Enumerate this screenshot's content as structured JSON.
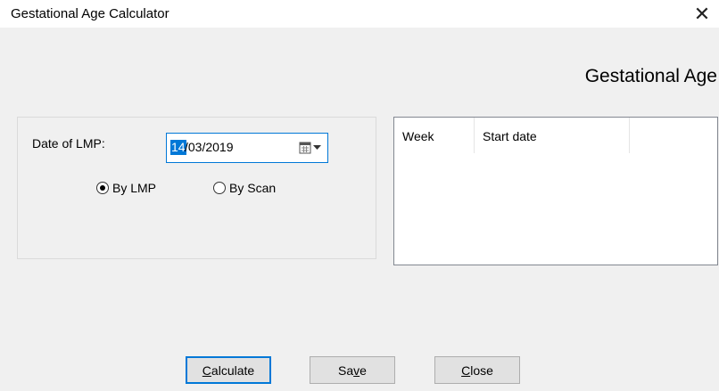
{
  "window": {
    "title": "Gestational Age Calculator",
    "close_glyph": "✕"
  },
  "heading": "Gestational Age",
  "lmp": {
    "label": "Date of LMP:",
    "date_day": "14",
    "date_rest": "/03/2019",
    "icon": "calendar-dropdown-icon"
  },
  "radios": [
    {
      "label": "By LMP",
      "checked": true
    },
    {
      "label": "By Scan",
      "checked": false
    }
  ],
  "table": {
    "columns": [
      "Week",
      "Start date",
      ""
    ],
    "rows": []
  },
  "buttons": {
    "calculate": {
      "pre": "",
      "mnemonic": "C",
      "post": "alculate"
    },
    "save": {
      "pre": "Sa",
      "mnemonic": "v",
      "post": "e"
    },
    "close": {
      "pre": "",
      "mnemonic": "C",
      "post": "lose"
    }
  },
  "colors": {
    "accent": "#0078d7",
    "background": "#f0f0f0"
  }
}
